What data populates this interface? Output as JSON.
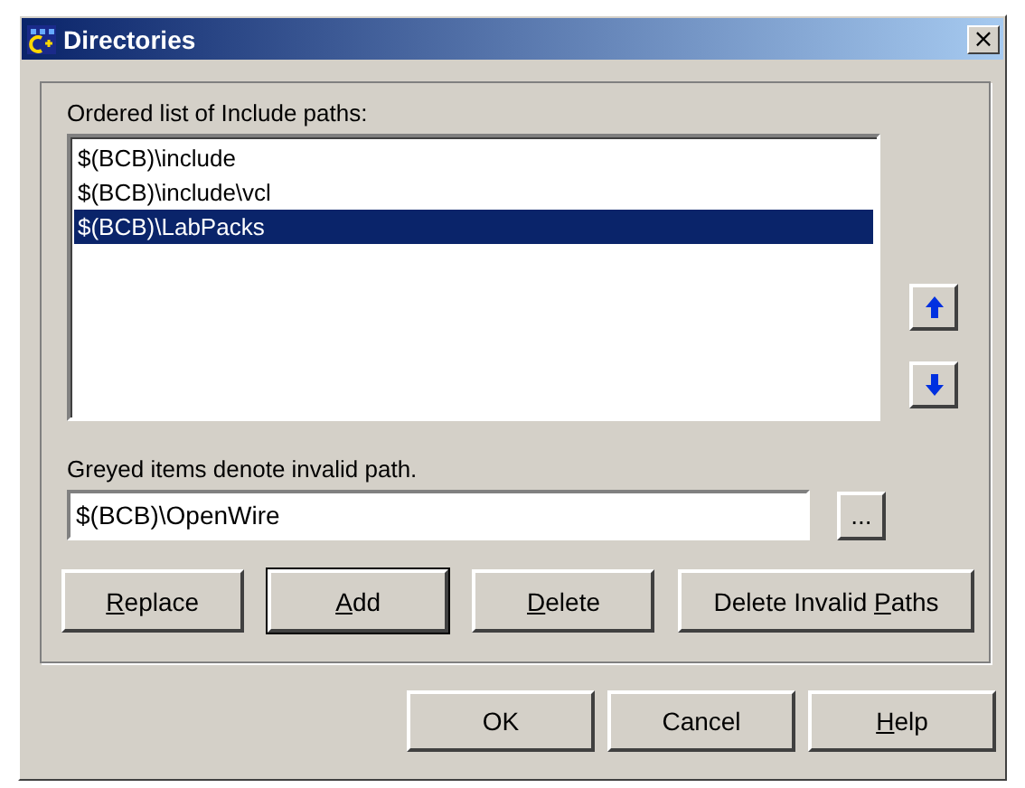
{
  "window": {
    "title": "Directories",
    "close": "×"
  },
  "list_label": "Ordered list of Include paths:",
  "paths": [
    {
      "text": "$(BCB)\\include",
      "selected": false
    },
    {
      "text": "$(BCB)\\include\\vcl",
      "selected": false
    },
    {
      "text": "$(BCB)\\LabPacks",
      "selected": true
    }
  ],
  "hint": "Greyed items denote invalid path.",
  "path_field": {
    "value": "$(BCB)\\OpenWire"
  },
  "browse_button": "...",
  "actions": [
    {
      "key": "R",
      "post": "eplace",
      "default": false
    },
    {
      "key": "A",
      "post": "dd",
      "default": true
    },
    {
      "key": "D",
      "post": "elete",
      "default": false
    },
    {
      "pre": "Delete Invalid ",
      "key": "P",
      "post": "aths",
      "default": false
    }
  ],
  "dialog_buttons": [
    {
      "pre": "OK"
    },
    {
      "pre": "Cancel"
    },
    {
      "key": "H",
      "post": "elp"
    }
  ]
}
